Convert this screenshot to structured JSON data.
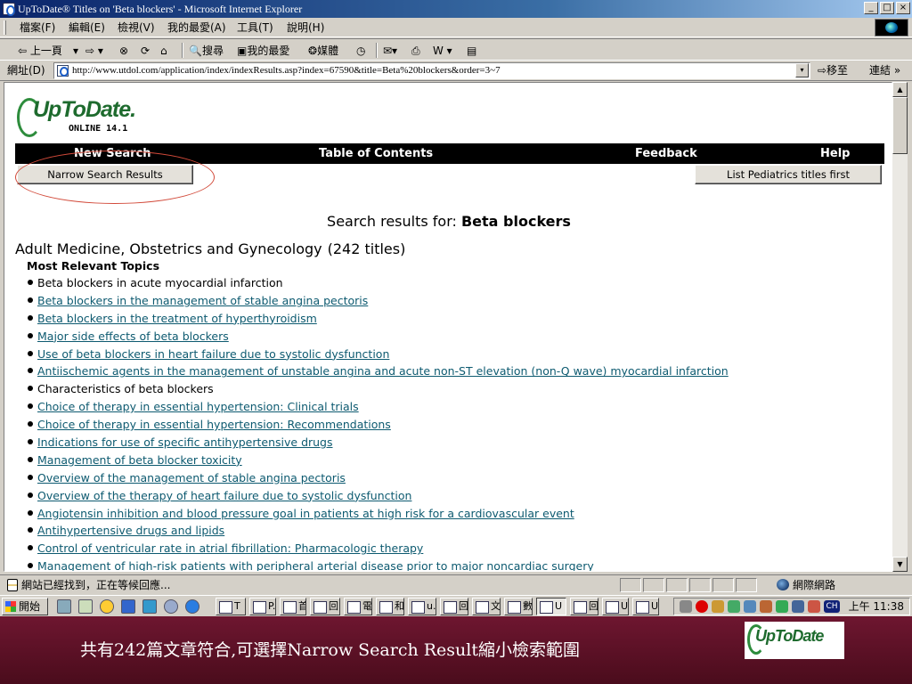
{
  "window": {
    "title": "UpToDate® Titles on 'Beta blockers' - Microsoft Internet Explorer",
    "controls": [
      "_",
      "□",
      "×"
    ]
  },
  "menubar": {
    "items": [
      "檔案(F)",
      "編輯(E)",
      "檢視(V)",
      "我的最愛(A)",
      "工具(T)",
      "說明(H)"
    ]
  },
  "toolbar": {
    "back": "⇦ 上一頁",
    "back_dropdown": "▾",
    "forward": "⇨ ▾",
    "stop": "⊗",
    "refresh": "⟳",
    "home": "⌂",
    "search": "搜尋",
    "favorites": "我的最愛",
    "media": "媒體",
    "history": "◷",
    "mail": "✉▾",
    "print": "⎙",
    "edit": "W ▾",
    "discuss": "▤"
  },
  "addressbar": {
    "label": "網址(D)",
    "url": "http://www.utdol.com/application/index/indexResults.asp?index=67590&title=Beta%20blockers&order=3~7",
    "dropdown": "▾",
    "go_label": "⇨移至",
    "links_label": "連結 »"
  },
  "page": {
    "logo": {
      "brand": "UpToDate",
      "dot": ".",
      "edition": "ONLINE 14.1"
    },
    "nav": {
      "new_search": "New Search",
      "table_of_contents": "Table of Contents",
      "feedback": "Feedback",
      "help": "Help"
    },
    "narrow_button": "Narrow Search Results",
    "pediatrics_button": "List Pediatrics titles first",
    "search_heading_prefix": "Search results for: ",
    "search_term": "Beta blockers",
    "section_title": "Adult Medicine, Obstetrics and Gynecology",
    "section_count": "(242 titles)",
    "subhead": "Most Relevant Topics",
    "results": [
      {
        "title": "Beta blockers in acute myocardial infarction",
        "link": false
      },
      {
        "title": "Beta blockers in the management of stable angina pectoris",
        "link": true
      },
      {
        "title": "Beta blockers in the treatment of hyperthyroidism",
        "link": true
      },
      {
        "title": "Major side effects of beta blockers",
        "link": true
      },
      {
        "title": "Use of beta blockers in heart failure due to systolic dysfunction",
        "link": true
      },
      {
        "title": "Antiischemic agents in the management of unstable angina and acute non-ST elevation (non-Q wave) myocardial infarction",
        "link": true
      },
      {
        "title": "Characteristics of beta blockers",
        "link": false
      },
      {
        "title": "Choice of therapy in essential hypertension: Clinical trials",
        "link": true
      },
      {
        "title": "Choice of therapy in essential hypertension: Recommendations",
        "link": true
      },
      {
        "title": "Indications for use of specific antihypertensive drugs",
        "link": true
      },
      {
        "title": "Management of beta blocker toxicity",
        "link": true
      },
      {
        "title": "Overview of the management of stable angina pectoris",
        "link": true
      },
      {
        "title": "Overview of the therapy of heart failure due to systolic dysfunction",
        "link": true
      },
      {
        "title": "Angiotensin inhibition and blood pressure goal in patients at high risk for a cardiovascular event",
        "link": true
      },
      {
        "title": "Antihypertensive drugs and lipids",
        "link": true
      },
      {
        "title": "Control of ventricular rate in atrial fibrillation: Pharmacologic therapy",
        "link": true
      },
      {
        "title": "Management of high-risk patients with peripheral arterial disease prior to major noncardiac surgery",
        "link": true
      }
    ]
  },
  "statusbar": {
    "text": "網站已經找到，正在等候回應...",
    "zone": "網際網路"
  },
  "taskbar": {
    "start": "開始",
    "tasks": [
      "T",
      "P.",
      "首",
      "回",
      "電",
      "和",
      "u.",
      "回",
      "文",
      "數",
      "U",
      "回",
      "U",
      "U"
    ],
    "clock": "上午 11:38",
    "lang": "CH"
  },
  "slide": {
    "caption": "共有242篇文章符合,可選擇Narrow Search Result縮小檢索範圍",
    "logo_brand": "UpToDate"
  },
  "colors": {
    "link": "#0d5a70",
    "nav_bg": "#000000",
    "highlight_ellipse": "#d24a3a",
    "logo_green": "#1e6b2e",
    "slide_bg": "#5c1126"
  }
}
